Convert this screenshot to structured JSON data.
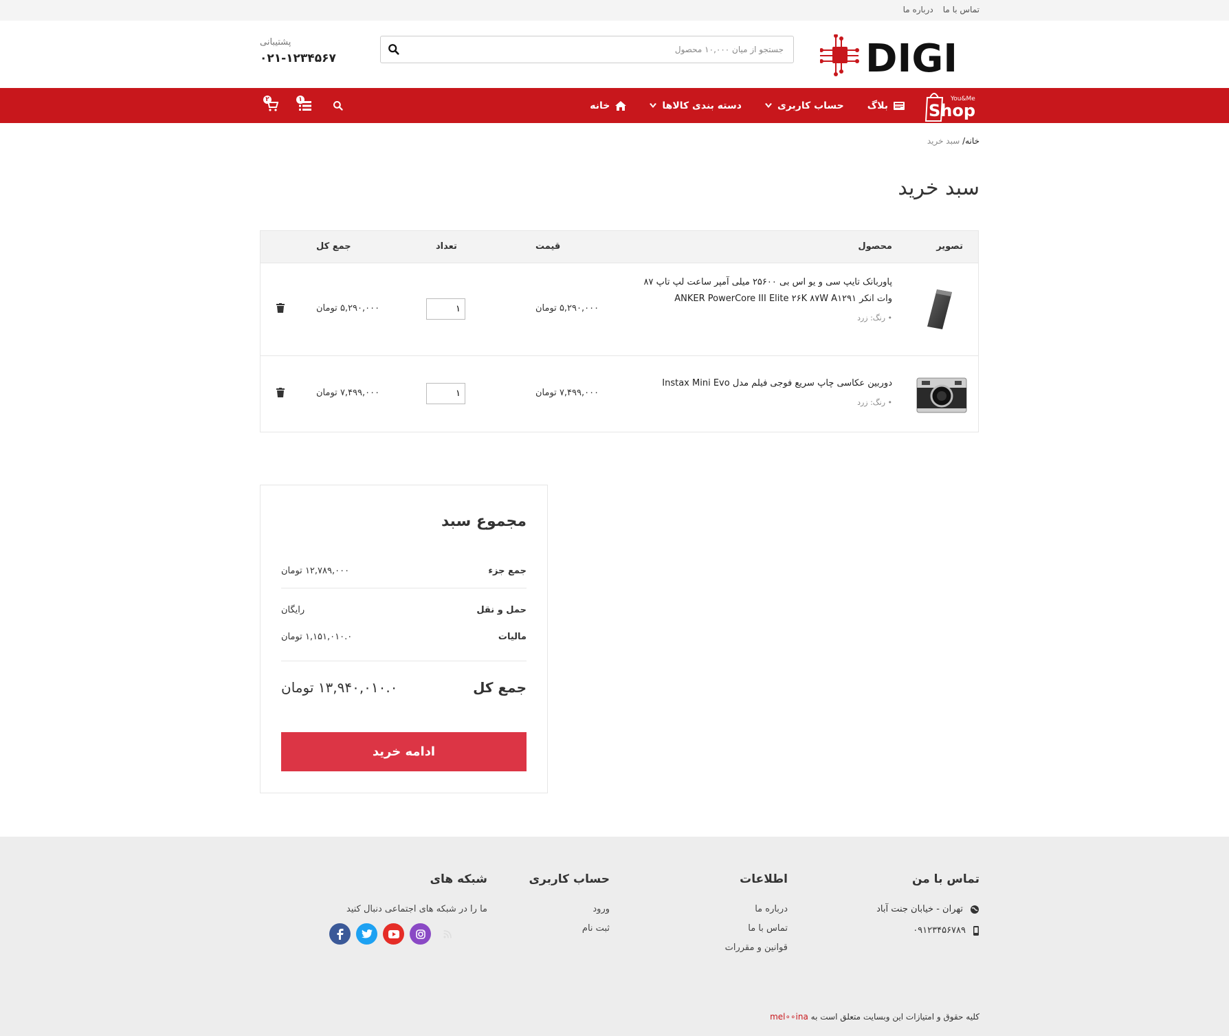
{
  "topbar": {
    "about": "درباره ما",
    "contact": "تماس با ما"
  },
  "header": {
    "logo_text": "DIGI",
    "search_placeholder": "جستجو از میان ۱۰,۰۰۰ محصول",
    "support_label": "پشتیبانی",
    "support_phone": "۰۲۱-۱۲۳۴۵۶۷"
  },
  "nav": {
    "shop_logo_top": "You&Me",
    "shop_logo_text": "Shop",
    "items": [
      {
        "label": "خانه",
        "icon": "home-icon"
      },
      {
        "label": "دسته بندی کالاها",
        "icon": "chevron-down-icon"
      },
      {
        "label": "حساب کاربری",
        "icon": "chevron-down-icon"
      },
      {
        "label": "بلاگ",
        "icon": "blog-icon"
      }
    ],
    "compare_count": "۱",
    "cart_count": "۲"
  },
  "breadcrumb": {
    "home": "خانه/",
    "current": "سبد خرید"
  },
  "page_title": "سبد خرید",
  "cart": {
    "headers": {
      "image": "تصویر",
      "product": "محصول",
      "price": "قیمت",
      "qty": "تعداد",
      "total": "جمع کل"
    },
    "rows": [
      {
        "name": "پاوربانک تایپ سی و یو اس بی ۲۵۶۰۰ میلی آمپر ساعت لپ تاپ ۸۷ وات انکر ANKER PowerCore III Elite ۲۶K ۸۷W A۱۲۹۱",
        "attr": "• رنگ: زرد",
        "price": "۵,۲۹۰,۰۰۰ تومان",
        "qty": "۱",
        "total": "۵,۲۹۰,۰۰۰ تومان"
      },
      {
        "name": "دوربین عکاسی چاپ سریع فوجی فیلم مدل Instax Mini Evo",
        "attr": "• رنگ: زرد",
        "price": "۷,۴۹۹,۰۰۰ تومان",
        "qty": "۱",
        "total": "۷,۴۹۹,۰۰۰ تومان"
      }
    ]
  },
  "totals": {
    "title": "مجموع سبد",
    "subtotal_label": "جمع جزء",
    "subtotal_value": "۱۲,۷۸۹,۰۰۰ تومان",
    "shipping_label": "حمل و نقل",
    "shipping_value": "رایگان",
    "tax_label": "مالیات",
    "tax_value": "۱,۱۵۱,۰۱۰.۰ تومان",
    "grand_label": "جمع کل",
    "grand_value": "۱۳,۹۴۰,۰۱۰.۰ تومان",
    "checkout_label": "ادامه خرید"
  },
  "footer": {
    "contact_title": "تماس با من",
    "address": "تهران - خیابان جنت آباد",
    "phone": "۰۹۱۲۳۴۵۶۷۸۹",
    "info_title": "اطلاعات",
    "info_links": [
      "درباره ما",
      "تماس با ما",
      "قوانین و مقررات"
    ],
    "account_title": "حساب کاربری",
    "account_links": [
      "ورود",
      "ثبت نام"
    ],
    "social_title": "شبکه های",
    "social_text": "ما را در شبکه های اجتماعی دنبال کنید",
    "copyright": "کلیه حقوق و امتیازات این وبسایت متعلق است به",
    "brand": "mel∘∘ina"
  },
  "colors": {
    "brand_red": "#c8171c",
    "button_red": "#dc3545"
  }
}
